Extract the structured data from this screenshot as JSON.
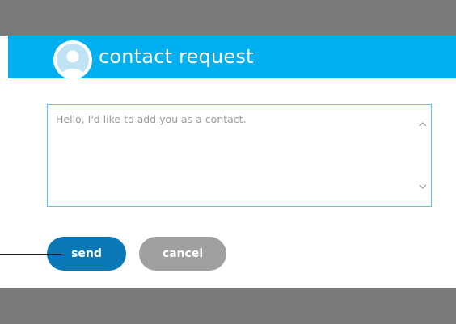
{
  "dialog": {
    "title": "contact request",
    "message": {
      "value": "Hello, I'd like to add you as a contact."
    },
    "buttons": {
      "send_label": "send",
      "cancel_label": "cancel"
    },
    "avatar_icon": "default-user-avatar-icon"
  },
  "colors": {
    "header": "#00aff0",
    "send_button": "#0a78b5",
    "cancel_button": "#a0a0a0",
    "input_border": "#5cc8f2",
    "backdrop": "#7a7a7a"
  }
}
